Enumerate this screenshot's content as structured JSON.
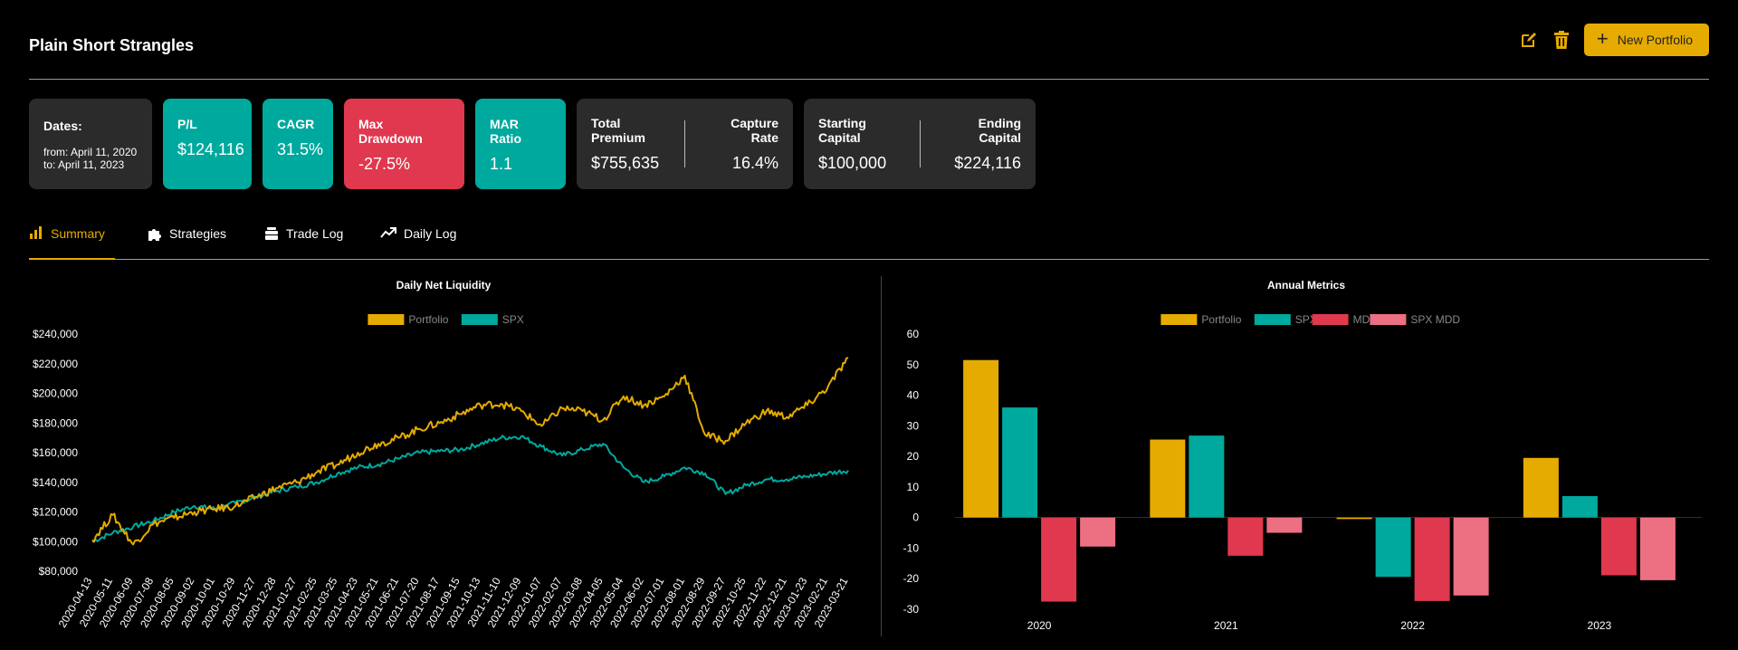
{
  "header": {
    "title": "Plain Short Strangles",
    "new_portfolio_label": "New Portfolio",
    "edit_icon": "edit-icon",
    "delete_icon": "trash-icon"
  },
  "cards": {
    "dates": {
      "label": "Dates:",
      "from": "from: April 11, 2020",
      "to": "to: April 11, 2023"
    },
    "pl": {
      "label": "P/L",
      "value": "$124,116"
    },
    "cagr": {
      "label": "CAGR",
      "value": "31.5%"
    },
    "max_drawdown": {
      "label": "Max Drawdown",
      "value": "-27.5%"
    },
    "mar_ratio": {
      "label": "MAR Ratio",
      "value": "1.1"
    },
    "total_premium": {
      "label": "Total Premium",
      "value": "$755,635"
    },
    "capture_rate": {
      "label": "Capture Rate",
      "value": "16.4%"
    },
    "starting_capital": {
      "label": "Starting Capital",
      "value": "$100,000"
    },
    "ending_capital": {
      "label": "Ending Capital",
      "value": "$224,116"
    }
  },
  "tabs": [
    {
      "label": "Summary",
      "icon": "bar-chart-icon",
      "active": true
    },
    {
      "label": "Strategies",
      "icon": "puzzle-icon",
      "active": false
    },
    {
      "label": "Trade Log",
      "icon": "stack-icon",
      "active": false
    },
    {
      "label": "Daily Log",
      "icon": "trend-up-icon",
      "active": false
    }
  ],
  "colors": {
    "accent": "#e6ab00",
    "teal": "#00a99d",
    "red": "#e0384e",
    "pink": "#ec6f82",
    "card": "#2b2b2b"
  },
  "chart_data": [
    {
      "type": "line",
      "title": "Daily Net Liquidity",
      "legend_position": "top",
      "ylim": [
        80000,
        240000
      ],
      "yticks": [
        80000,
        100000,
        120000,
        140000,
        160000,
        180000,
        200000,
        220000,
        240000
      ],
      "ytick_labels": [
        "$80,000",
        "$100,000",
        "$120,000",
        "$140,000",
        "$160,000",
        "$180,000",
        "$200,000",
        "$220,000",
        "$240,000"
      ],
      "x": [
        "2020-04-13",
        "2020-05-11",
        "2020-06-09",
        "2020-07-08",
        "2020-08-05",
        "2020-09-02",
        "2020-10-01",
        "2020-10-29",
        "2020-11-27",
        "2020-12-28",
        "2021-01-27",
        "2021-02-25",
        "2021-03-25",
        "2021-04-23",
        "2021-05-21",
        "2021-06-21",
        "2021-07-20",
        "2021-08-17",
        "2021-09-15",
        "2021-10-13",
        "2021-11-10",
        "2021-12-09",
        "2022-01-07",
        "2022-02-07",
        "2022-03-08",
        "2022-04-05",
        "2022-05-04",
        "2022-06-02",
        "2022-07-01",
        "2022-08-01",
        "2022-08-29",
        "2022-09-27",
        "2022-10-25",
        "2022-11-22",
        "2022-12-21",
        "2023-01-23",
        "2023-02-21",
        "2023-03-21"
      ],
      "series": [
        {
          "name": "Portfolio",
          "color": "#e6ab00",
          "values": [
            101000,
            118000,
            98000,
            112000,
            116000,
            120000,
            122000,
            124000,
            130000,
            136000,
            140000,
            147000,
            152000,
            160000,
            166000,
            170000,
            176000,
            180000,
            186000,
            192000,
            193000,
            188000,
            178000,
            190000,
            188000,
            182000,
            198000,
            192000,
            198000,
            212000,
            172000,
            168000,
            180000,
            188000,
            184000,
            192000,
            204000,
            224000
          ]
        },
        {
          "name": "SPX",
          "color": "#00a99d",
          "values": [
            100000,
            106000,
            110000,
            114000,
            120000,
            124000,
            122000,
            126000,
            130000,
            134000,
            137000,
            140000,
            146000,
            150000,
            152000,
            156000,
            160000,
            161000,
            162000,
            166000,
            170000,
            171000,
            164000,
            158000,
            162000,
            166000,
            150000,
            140000,
            144000,
            150000,
            146000,
            132000,
            138000,
            142000,
            142000,
            144000,
            146000,
            148000
          ]
        }
      ]
    },
    {
      "type": "bar",
      "title": "Annual Metrics",
      "legend_position": "top",
      "categories": [
        "2020",
        "2021",
        "2022",
        "2023"
      ],
      "ylim": [
        -30,
        60
      ],
      "yticks": [
        -30,
        -20,
        -10,
        0,
        10,
        20,
        30,
        40,
        50,
        60
      ],
      "series": [
        {
          "name": "Portfolio",
          "color": "#e6ab00",
          "values": [
            51.5,
            25.5,
            -0.5,
            19.5
          ]
        },
        {
          "name": "SPX",
          "color": "#00a99d",
          "values": [
            36,
            26.8,
            -19.4,
            7
          ]
        },
        {
          "name": "MDD",
          "color": "#e0384e",
          "values": [
            -27.5,
            -12.5,
            -27.3,
            -18.9
          ]
        },
        {
          "name": "SPX MDD",
          "color": "#ec6f82",
          "values": [
            -9.5,
            -5,
            -25.5,
            -20.5
          ]
        }
      ]
    }
  ]
}
